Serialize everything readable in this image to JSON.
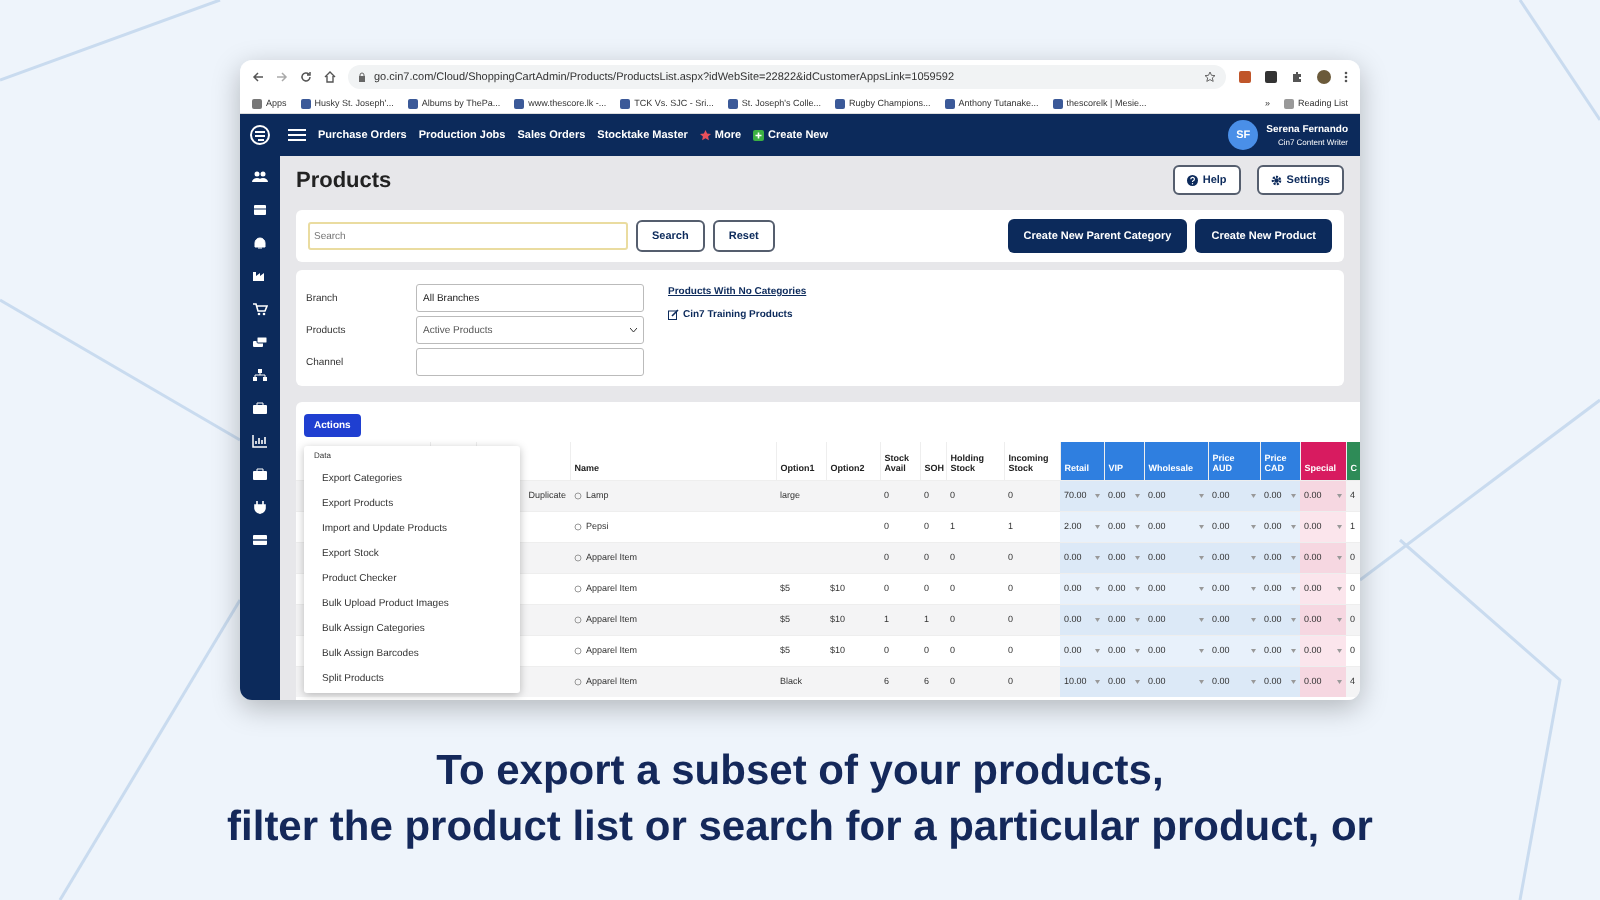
{
  "caption": [
    "To export a subset of your products,",
    "filter the product list or search for a particular product, or"
  ],
  "browser": {
    "url": "go.cin7.com/Cloud/ShoppingCartAdmin/Products/ProductsList.aspx?idWebSite=22822&idCustomerAppsLink=1059592",
    "bookmarks": [
      "Apps",
      "Husky St. Joseph'...",
      "Albums by ThePa...",
      "www.thescore.lk -...",
      "TCK Vs. SJC - Sri...",
      "St. Joseph's Colle...",
      "Rugby Champions...",
      "Anthony Tutanake...",
      "thescorelk | Mesie..."
    ],
    "more_bookmarks": "»",
    "reading_list": "Reading List"
  },
  "navbar": {
    "items": [
      {
        "label": "Purchase Orders",
        "kind": "plain"
      },
      {
        "label": "Production Jobs",
        "kind": "plain"
      },
      {
        "label": "Sales Orders",
        "kind": "plain"
      },
      {
        "label": "Stocktake Master",
        "kind": "plain"
      },
      {
        "label": "More",
        "kind": "star"
      },
      {
        "label": "Create New",
        "kind": "plus"
      }
    ],
    "user": {
      "initials": "SF",
      "name": "Serena Fernando",
      "role": "Cin7 Content Writer"
    }
  },
  "page": {
    "title": "Products",
    "header_buttons": [
      "Help",
      "Settings"
    ]
  },
  "search": {
    "placeholder": "Search",
    "buttons": [
      "Search",
      "Reset"
    ],
    "create_buttons": [
      "Create New Parent Category",
      "Create New Product"
    ]
  },
  "filters": {
    "fields": [
      {
        "label": "Branch",
        "value": "All Branches",
        "kind": "input"
      },
      {
        "label": "Products",
        "value": "Active Products",
        "kind": "select"
      },
      {
        "label": "Channel",
        "kind": "input"
      }
    ],
    "links": [
      "Products With No Categories",
      "Cin7 Training Products"
    ]
  },
  "actions": {
    "label": "Actions",
    "menu_header": "Data",
    "menu_items": [
      "Export Categories",
      "Export Products",
      "Import and Update Products",
      "Export Stock",
      "Product Checker",
      "Bulk Upload Product Images",
      "Bulk Assign Categories",
      "Bulk Assign Barcodes",
      "Split Products"
    ]
  },
  "table": {
    "columns": [
      {
        "kind": "blank"
      },
      {
        "kind": "blank"
      },
      {
        "kind": "text"
      },
      {
        "label": "Name",
        "kind": "name"
      },
      {
        "label": "Option1",
        "kind": "text"
      },
      {
        "label": "Option2",
        "kind": "text"
      },
      {
        "label": "Stock Avail",
        "kind": "number"
      },
      {
        "label": "SOH",
        "kind": "number"
      },
      {
        "label": "Holding Stock",
        "kind": "number"
      },
      {
        "label": "Incoming Stock",
        "kind": "number"
      },
      {
        "label": "Retail",
        "kind": "price",
        "color": "#2f7fe0"
      },
      {
        "label": "VIP",
        "kind": "price",
        "color": "#2f7fe0"
      },
      {
        "label": "Wholesale",
        "kind": "price",
        "color": "#2f7fe0"
      },
      {
        "label": "Price AUD",
        "kind": "price",
        "color": "#2f7fe0"
      },
      {
        "label": "Price CAD",
        "kind": "price",
        "color": "#2f7fe0"
      },
      {
        "label": "Special",
        "kind": "price",
        "color": "#d81b60"
      },
      {
        "label": "C",
        "kind": "text",
        "color": "#2e8b57"
      }
    ],
    "rows": [
      {
        "cells": [
          null,
          null,
          "Duplicate",
          "Lamp",
          "large",
          null,
          "0",
          "0",
          "0",
          "0",
          "70.00",
          "0.00",
          "0.00",
          "0.00",
          "0.00",
          "0.00",
          "4"
        ]
      },
      {
        "cells": [
          null,
          null,
          null,
          "Pepsi",
          null,
          null,
          "0",
          "0",
          "1",
          "1",
          "2.00",
          "0.00",
          "0.00",
          "0.00",
          "0.00",
          "0.00",
          "1"
        ]
      },
      {
        "cells": [
          null,
          null,
          null,
          "Apparel Item",
          null,
          null,
          "0",
          "0",
          "0",
          "0",
          "0.00",
          "0.00",
          "0.00",
          "0.00",
          "0.00",
          "0.00",
          "0"
        ]
      },
      {
        "cells": [
          null,
          null,
          null,
          "Apparel Item",
          "$5",
          "$10",
          "0",
          "0",
          "0",
          "0",
          "0.00",
          "0.00",
          "0.00",
          "0.00",
          "0.00",
          "0.00",
          "0"
        ]
      },
      {
        "cells": [
          null,
          null,
          null,
          "Apparel Item",
          "$5",
          "$10",
          "1",
          "1",
          "0",
          "0",
          "0.00",
          "0.00",
          "0.00",
          "0.00",
          "0.00",
          "0.00",
          "0"
        ]
      },
      {
        "cells": [
          null,
          null,
          null,
          "Apparel Item",
          "$5",
          "$10",
          "0",
          "0",
          "0",
          "0",
          "0.00",
          "0.00",
          "0.00",
          "0.00",
          "0.00",
          "0.00",
          "0"
        ]
      },
      {
        "cells": [
          null,
          null,
          null,
          "Apparel Item",
          "Black",
          null,
          "6",
          "6",
          "0",
          "0",
          "10.00",
          "0.00",
          "0.00",
          "0.00",
          "0.00",
          "0.00",
          "4"
        ]
      }
    ]
  }
}
